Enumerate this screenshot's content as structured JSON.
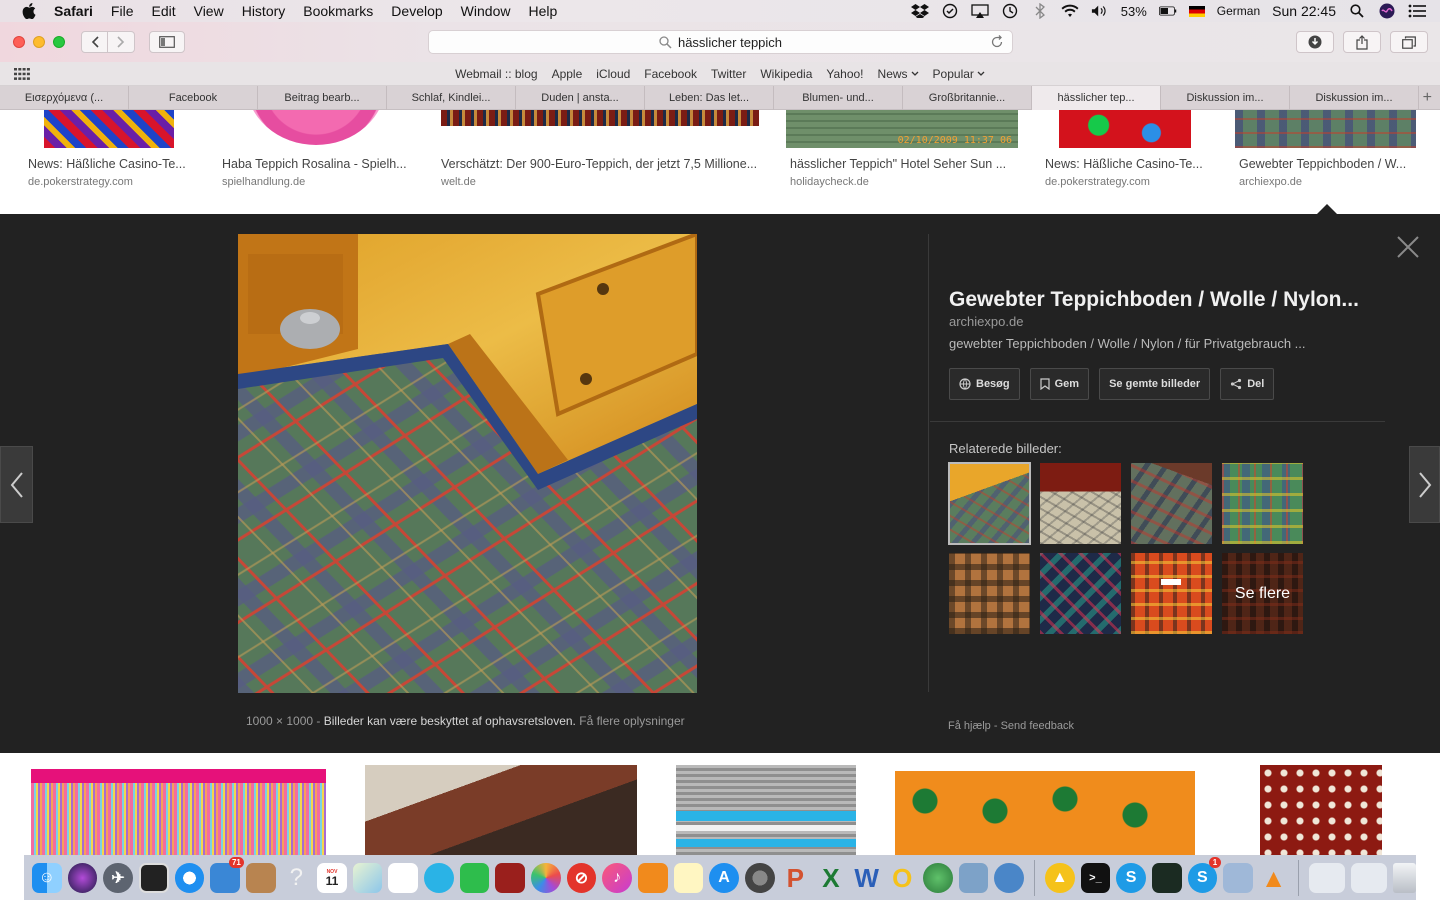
{
  "menubar": {
    "app": "Safari",
    "items": [
      "File",
      "Edit",
      "View",
      "History",
      "Bookmarks",
      "Develop",
      "Window",
      "Help"
    ],
    "battery": "53%",
    "language": "German",
    "clock": "Sun 22:45"
  },
  "toolbar": {
    "url": "hässlicher teppich"
  },
  "favorites": [
    "Webmail :: blog",
    "Apple",
    "iCloud",
    "Facebook",
    "Twitter",
    "Wikipedia",
    "Yahoo!",
    "News",
    "Popular"
  ],
  "tabs": [
    {
      "label": "Εισερχόμενα (..."
    },
    {
      "label": "Facebook"
    },
    {
      "label": "Beitrag bearb..."
    },
    {
      "label": "Schlaf, Kindlei..."
    },
    {
      "label": "Duden | ansta..."
    },
    {
      "label": "Leben: Das let..."
    },
    {
      "label": "Blumen- und..."
    },
    {
      "label": "Großbritannie..."
    },
    {
      "label": "hässlicher tep..."
    },
    {
      "label": "Diskussion im..."
    },
    {
      "label": "Diskussion im..."
    }
  ],
  "top_results": [
    {
      "title": "News: Häßliche Casino-Te...",
      "domain": "de.pokerstrategy.com"
    },
    {
      "title": "Haba Teppich Rosalina - Spielh...",
      "domain": "spielhandlung.de"
    },
    {
      "title": "Verschätzt: Der 900-Euro-Teppich, der jetzt 7,5 Millione...",
      "domain": "welt.de"
    },
    {
      "title": "hässlicher Teppich\" Hotel Seher Sun ...",
      "domain": "holidaycheck.de",
      "timestamp": "02/10/2009 11:37 06"
    },
    {
      "title": "News: Häßliche Casino-Te...",
      "domain": "de.pokerstrategy.com"
    },
    {
      "title": "Gewebter Teppichboden / W...",
      "domain": "archiexpo.de"
    }
  ],
  "preview": {
    "title": "Gewebter Teppichboden / Wolle / Nylon...",
    "domain": "archiexpo.de",
    "description": "gewebter Teppichboden / Wolle / Nylon / für Privatgebrauch ...",
    "actions": [
      {
        "label": "Besøg",
        "icon": "globe-icon"
      },
      {
        "label": "Gem",
        "icon": "bookmark-icon"
      },
      {
        "label": "Se gemte billeder",
        "icon": ""
      },
      {
        "label": "Del",
        "icon": "share-icon"
      }
    ],
    "related_label": "Relaterede billeder:",
    "see_more": "Se flere",
    "image_size": "1000 × 1000",
    "separator": "-",
    "copyright": "Billeder kan være beskyttet af ophavsretsloven.",
    "more_info": "Få flere oplysninger",
    "help": "Få hjælp",
    "feedback": "Send feedback",
    "footer_sep": "-"
  },
  "dock": {
    "badge_mail": "71",
    "badge_skype": "1",
    "calendar_month": "NOV",
    "calendar_day": "11"
  }
}
